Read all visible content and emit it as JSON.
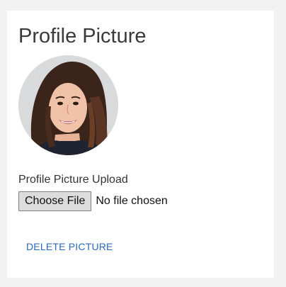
{
  "profile": {
    "title": "Profile Picture",
    "upload_label": "Profile Picture Upload",
    "choose_button": "Choose File",
    "file_status": "No file chosen",
    "delete_link": "DELETE PICTURE"
  },
  "colors": {
    "page_background": "#f2f2f2",
    "panel_background": "#ffffff",
    "link": "#2a6ab8",
    "button_background": "#dcdcdc"
  }
}
